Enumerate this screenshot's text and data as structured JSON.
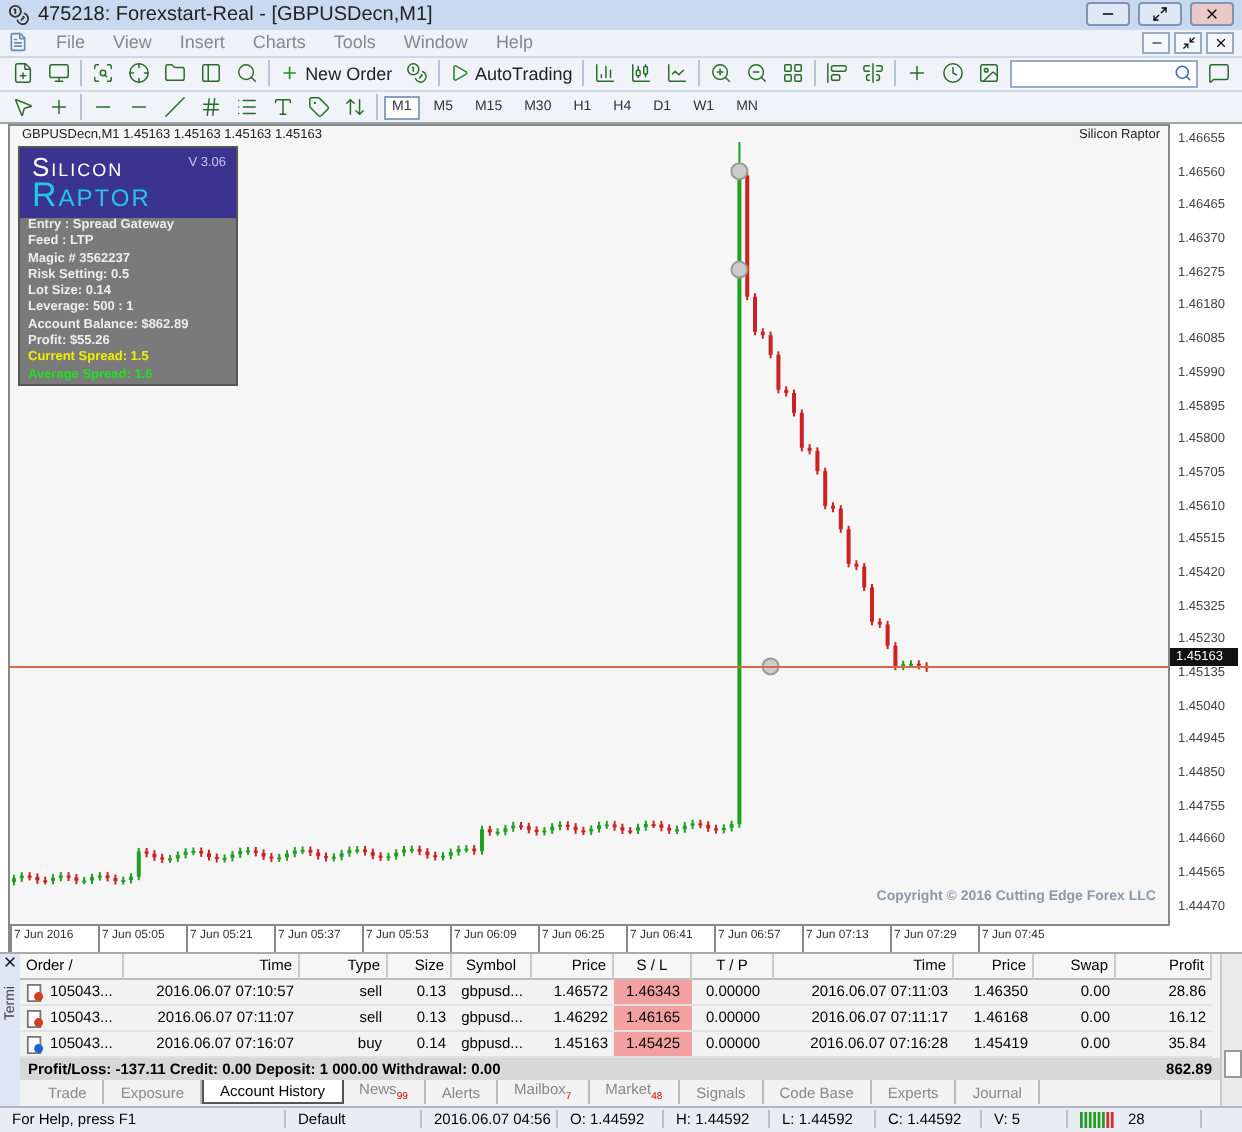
{
  "window": {
    "title": "475218: Forexstart-Real - [GBPUSDecn,M1]"
  },
  "menu": [
    "File",
    "View",
    "Insert",
    "Charts",
    "Tools",
    "Window",
    "Help"
  ],
  "toolbar": {
    "new_order": "New Order",
    "autotrading": "AutoTrading"
  },
  "timeframes": [
    {
      "label": "M1",
      "selected": true
    },
    {
      "label": "M5",
      "selected": false
    },
    {
      "label": "M15",
      "selected": false
    },
    {
      "label": "M30",
      "selected": false
    },
    {
      "label": "H1",
      "selected": false
    },
    {
      "label": "H4",
      "selected": false
    },
    {
      "label": "D1",
      "selected": false
    },
    {
      "label": "W1",
      "selected": false
    },
    {
      "label": "MN",
      "selected": false
    }
  ],
  "chart": {
    "header": "GBPUSDecn,M1  1.45163 1.45163 1.45163 1.45163",
    "expert": "Silicon Raptor",
    "panel": {
      "brand_top": "Silicon",
      "brand_bottom": "Raptor",
      "version": "V 3.06",
      "lines": [
        {
          "text": "Entry : Spread Gateway",
          "kind": "info"
        },
        {
          "text": "Feed  : LTP",
          "kind": "info"
        },
        {
          "text": "Magic # 3562237",
          "kind": "info"
        },
        {
          "text": "Risk Setting: 0.5",
          "kind": "info"
        },
        {
          "text": "Lot Size: 0.14",
          "kind": "info"
        },
        {
          "text": "Leverage: 500 : 1",
          "kind": "info"
        },
        {
          "text": "Account Balance: $862.89",
          "kind": "info"
        },
        {
          "text": "Profit: $55.26",
          "kind": "info"
        },
        {
          "text": "Current Spread:  1.5",
          "kind": "current"
        },
        {
          "text": "Average Spread: 1.6",
          "kind": "average"
        }
      ]
    },
    "copyright": "Copyright © 2016 Cutting Edge Forex LLC",
    "price_labels": [
      "1.46655",
      "1.46560",
      "1.46465",
      "1.46370",
      "1.46275",
      "1.46180",
      "1.46085",
      "1.45990",
      "1.45895",
      "1.45800",
      "1.45705",
      "1.45610",
      "1.45515",
      "1.45420",
      "1.45325",
      "1.45230",
      "1.45135",
      "1.45040",
      "1.44945",
      "1.44850",
      "1.44755",
      "1.44660",
      "1.44565",
      "1.44470"
    ],
    "current_price": "1.45163",
    "time_labels": [
      "7 Jun 2016",
      "7 Jun 05:05",
      "7 Jun 05:21",
      "7 Jun 05:37",
      "7 Jun 05:53",
      "7 Jun 06:09",
      "7 Jun 06:25",
      "7 Jun 06:41",
      "7 Jun 06:57",
      "7 Jun 07:13",
      "7 Jun 07:29",
      "7 Jun 07:45"
    ]
  },
  "terminal": {
    "side_label": "Termi",
    "columns": [
      "Order  /",
      "Time",
      "Type",
      "Size",
      "Symbol",
      "Price",
      "S / L",
      "T / P",
      "Time",
      "Price",
      "Swap",
      "Profit"
    ],
    "rows": [
      {
        "kind": "sell",
        "cells": [
          "105043...",
          "2016.06.07 07:10:57",
          "sell",
          "0.13",
          "gbpusd...",
          "1.46572",
          "1.46343",
          "0.00000",
          "2016.06.07 07:11:03",
          "1.46350",
          "0.00",
          "28.86"
        ]
      },
      {
        "kind": "sell",
        "cells": [
          "105043...",
          "2016.06.07 07:11:07",
          "sell",
          "0.13",
          "gbpusd...",
          "1.46292",
          "1.46165",
          "0.00000",
          "2016.06.07 07:11:17",
          "1.46168",
          "0.00",
          "16.12"
        ]
      },
      {
        "kind": "buy",
        "cells": [
          "105043...",
          "2016.06.07 07:16:07",
          "buy",
          "0.14",
          "gbpusd...",
          "1.45163",
          "1.45425",
          "0.00000",
          "2016.06.07 07:16:28",
          "1.45419",
          "0.00",
          "35.84"
        ]
      }
    ],
    "summary": "Profit/Loss: -137.11  Credit: 0.00  Deposit: 1 000.00  Withdrawal: 0.00",
    "total": "862.89",
    "tabs": [
      {
        "label": "Trade",
        "selected": false
      },
      {
        "label": "Exposure",
        "selected": false
      },
      {
        "label": "Account History",
        "selected": true
      },
      {
        "label": "News",
        "count": "99",
        "selected": false
      },
      {
        "label": "Alerts",
        "selected": false
      },
      {
        "label": "Mailbox",
        "count": "7",
        "selected": false
      },
      {
        "label": "Market",
        "count": "48",
        "selected": false
      },
      {
        "label": "Signals",
        "selected": false
      },
      {
        "label": "Code Base",
        "selected": false
      },
      {
        "label": "Experts",
        "selected": false
      },
      {
        "label": "Journal",
        "selected": false
      }
    ]
  },
  "status_bar": [
    "For Help, press F1",
    "Default",
    "2016.06.07 04:56",
    "O: 1.44592",
    "H: 1.44592",
    "L: 1.44592",
    "C: 1.44592",
    "V: 5"
  ],
  "traffic": "28"
}
